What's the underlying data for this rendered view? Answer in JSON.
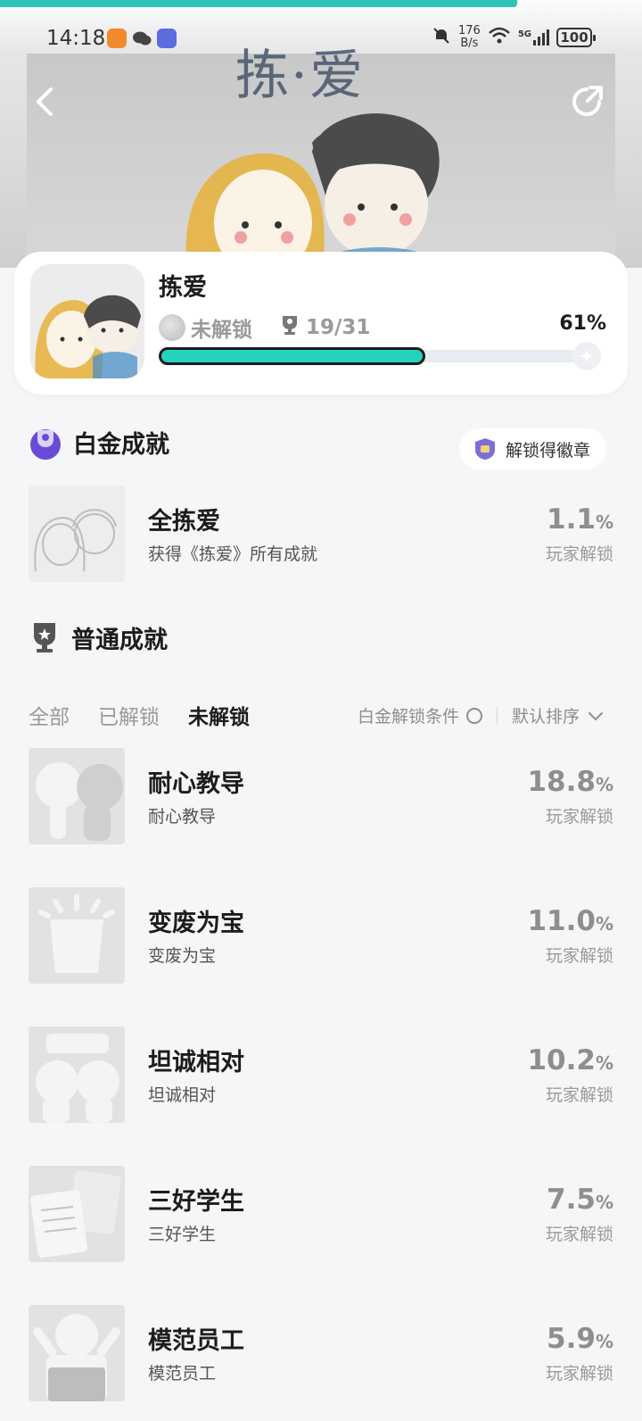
{
  "status_bar": {
    "time": "14:18",
    "net_speed_value": "176",
    "net_speed_unit": "B/s",
    "signal_label": "5G",
    "battery": "100"
  },
  "header": {
    "banner_title": "拣·爱",
    "back_icon": "chevron-left-icon",
    "share_icon": "share-icon"
  },
  "game": {
    "name": "拣爱",
    "platinum_status": "未解锁",
    "trophy_count": "19/31",
    "progress_percent_text": "61%",
    "progress_fraction": 0.61,
    "accent_color": "#24d3be"
  },
  "platinum_section": {
    "title": "白金成就",
    "badge_button_label": "解锁得徽章",
    "achievement": {
      "name": "全拣爱",
      "description": "获得《拣爱》所有成就",
      "percent_value": "1.1",
      "percent_unit": "%",
      "percent_label": "玩家解锁"
    }
  },
  "normal_section": {
    "title": "普通成就",
    "tabs": [
      "全部",
      "已解锁",
      "未解锁"
    ],
    "active_tab": "未解锁",
    "filter_condition_label": "白金解锁条件",
    "sort_label": "默认排序",
    "achievements": [
      {
        "name": "耐心教导",
        "description": "耐心教导",
        "percent_value": "18.8",
        "percent_unit": "%",
        "percent_label": "玩家解锁"
      },
      {
        "name": "变废为宝",
        "description": "变废为宝",
        "percent_value": "11.0",
        "percent_unit": "%",
        "percent_label": "玩家解锁"
      },
      {
        "name": "坦诚相对",
        "description": "坦诚相对",
        "percent_value": "10.2",
        "percent_unit": "%",
        "percent_label": "玩家解锁"
      },
      {
        "name": "三好学生",
        "description": "三好学生",
        "percent_value": "7.5",
        "percent_unit": "%",
        "percent_label": "玩家解锁"
      },
      {
        "name": "模范员工",
        "description": "模范员工",
        "percent_value": "5.9",
        "percent_unit": "%",
        "percent_label": "玩家解锁"
      }
    ]
  }
}
